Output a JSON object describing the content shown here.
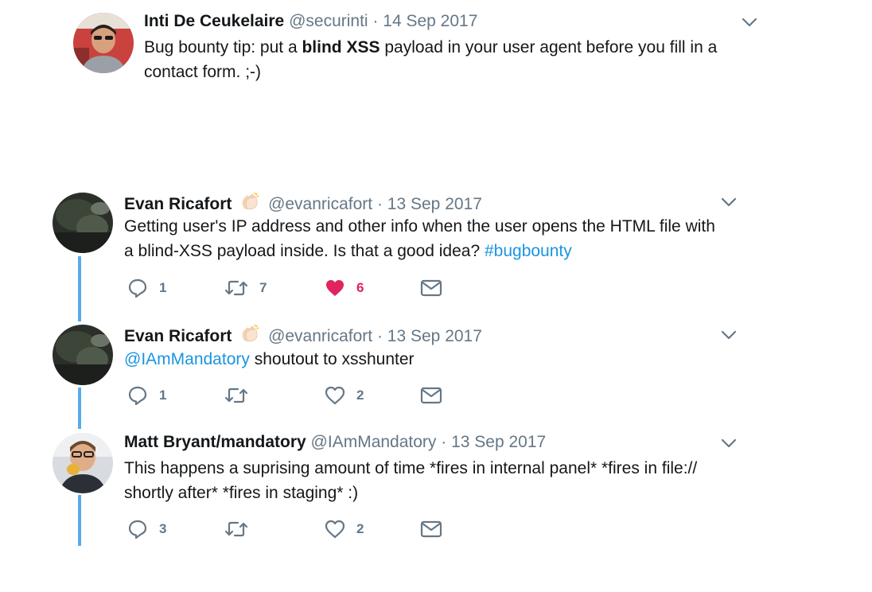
{
  "tweets": [
    {
      "name": "Inti De Ceukelaire",
      "handle": "@securinti",
      "sep": "·",
      "date": "14 Sep 2017",
      "text_pre": "Bug bounty tip: put a ",
      "text_bold": "blind XSS",
      "text_post": " payload in your user agent before you fill in a",
      "text_line2": "contact form. ;-)"
    },
    {
      "name": "Evan Ricafort",
      "handle": "@evanricafort",
      "sep": "·",
      "date": "13 Sep 2017",
      "text_line1": "Getting user's IP address and other info when the user opens the HTML file with",
      "text_line2_pre": "a blind-XSS payload inside. Is that a good idea? ",
      "hashtag": "#bugbounty",
      "replies": "1",
      "retweets": "7",
      "likes": "6"
    },
    {
      "name": "Evan Ricafort",
      "handle": "@evanricafort",
      "sep": "·",
      "date": "13 Sep 2017",
      "mention": "@IAmMandatory",
      "text_post": " shoutout to xsshunter",
      "replies": "1",
      "retweets": "",
      "likes": "2"
    },
    {
      "name": "Matt Bryant/mandatory",
      "handle": "@IAmMandatory",
      "sep": "·",
      "date": "13 Sep 2017",
      "text_line1": "This happens a suprising amount of time *fires in internal panel* *fires in file://",
      "text_line2": "shortly after* *fires in staging* :)",
      "replies": "3",
      "retweets": "",
      "likes": "2"
    }
  ],
  "colors": {
    "link": "#1b95e0",
    "thread_line": "#55acee",
    "like_active": "#e0245e",
    "muted": "#657786"
  },
  "icons": [
    "reply-icon",
    "retweet-icon",
    "like-icon",
    "direct-message-icon",
    "chevron-down-icon",
    "clapping-hands-emoji"
  ]
}
